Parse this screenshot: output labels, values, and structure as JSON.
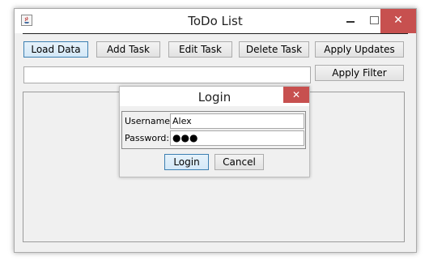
{
  "window": {
    "title": "ToDo List",
    "close_glyph": "✕"
  },
  "toolbar": {
    "load_data": "Load Data",
    "add_task": "Add Task",
    "edit_task": "Edit Task",
    "delete_task": "Delete Task",
    "apply_updates": "Apply Updates",
    "apply_filter": "Apply Filter"
  },
  "filter": {
    "value": ""
  },
  "login_dialog": {
    "title": "Login",
    "close_glyph": "✕",
    "username_label": "Username:",
    "username_value": "Alex",
    "password_label": "Password:",
    "password_value": "●●●",
    "login_button": "Login",
    "cancel_button": "Cancel"
  },
  "colors": {
    "close_button": "#c7504f",
    "focus_border": "#3c7fb1"
  },
  "icons": [
    "app-icon",
    "minimize-icon",
    "maximize-icon",
    "close-icon"
  ]
}
